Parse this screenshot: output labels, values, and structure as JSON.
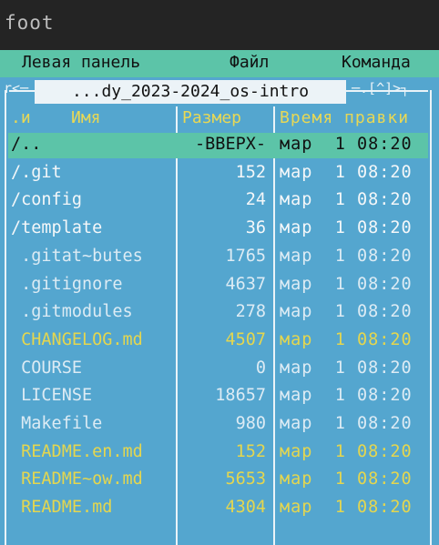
{
  "window": {
    "title": "foot"
  },
  "menu": {
    "left": "Левая панель",
    "file": "Файл",
    "command": "Команда"
  },
  "panel": {
    "path": "...dy_2023-2024_os-intro",
    "corner_left": "r<─",
    "corner_right": "─.[^]>┐",
    "headers": {
      "sort": ".и",
      "name": "Имя",
      "size": "Размер",
      "time": "Время правки"
    },
    "rows": [
      {
        "name": "/..",
        "size": "-ВВЕРХ-",
        "time": "мар  1 08:20",
        "style": "selected"
      },
      {
        "name": "/.git",
        "size": "152",
        "time": "мар  1 08:20",
        "style": "dir"
      },
      {
        "name": "/config",
        "size": "24",
        "time": "мар  1 08:20",
        "style": "dir"
      },
      {
        "name": "/template",
        "size": "36",
        "time": "мар  1 08:20",
        "style": "dir"
      },
      {
        "name": " .gitat~butes",
        "size": "1765",
        "time": "мар  1 08:20",
        "style": "hidden"
      },
      {
        "name": " .gitignore",
        "size": "4637",
        "time": "мар  1 08:20",
        "style": "hidden"
      },
      {
        "name": " .gitmodules",
        "size": "278",
        "time": "мар  1 08:20",
        "style": "hidden"
      },
      {
        "name": " CHANGELOG.md",
        "size": "4507",
        "time": "мар  1 08:20",
        "style": "doc"
      },
      {
        "name": " COURSE",
        "size": "0",
        "time": "мар  1 08:20",
        "style": "file"
      },
      {
        "name": " LICENSE",
        "size": "18657",
        "time": "мар  1 08:20",
        "style": "file"
      },
      {
        "name": " Makefile",
        "size": "980",
        "time": "мар  1 08:20",
        "style": "file"
      },
      {
        "name": " README.en.md",
        "size": "152",
        "time": "мар  1 08:20",
        "style": "doc"
      },
      {
        "name": " README~ow.md",
        "size": "5653",
        "time": "мар  1 08:20",
        "style": "doc"
      },
      {
        "name": " README.md",
        "size": "4304",
        "time": "мар  1 08:20",
        "style": "doc"
      }
    ]
  }
}
